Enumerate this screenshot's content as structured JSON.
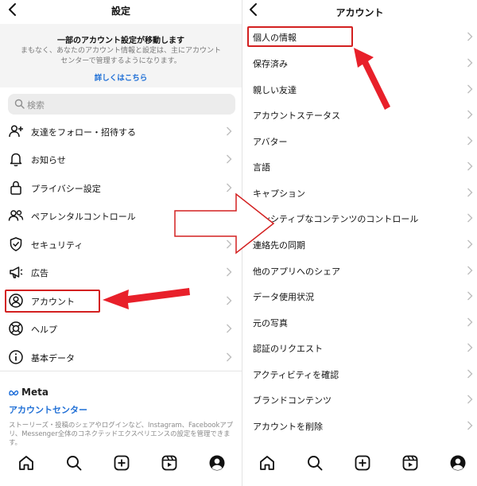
{
  "left_panel": {
    "title": "設定",
    "notice": {
      "title": "一部のアカウント設定が移動します",
      "body": "まもなく、あなたのアカウント情報と設定は、主にアカウントセンターで管理するようになります。",
      "link": "詳しくはこちら"
    },
    "search_placeholder": "検索",
    "items": [
      {
        "label": "友達をフォロー・招待する",
        "icon": "add-person-icon"
      },
      {
        "label": "お知らせ",
        "icon": "bell-icon"
      },
      {
        "label": "プライバシー設定",
        "icon": "lock-icon"
      },
      {
        "label": "ペアレンタルコントロール",
        "icon": "people-icon"
      },
      {
        "label": "セキュリティ",
        "icon": "shield-check-icon"
      },
      {
        "label": "広告",
        "icon": "megaphone-icon"
      },
      {
        "label": "アカウント",
        "icon": "user-circle-icon"
      },
      {
        "label": "ヘルプ",
        "icon": "lifebuoy-icon"
      },
      {
        "label": "基本データ",
        "icon": "info-icon"
      }
    ],
    "meta_logo": "Meta",
    "accounts_center": "アカウントセンター",
    "accounts_center_desc": "ストーリーズ・投稿のシェアやログインなど、Instagram、Facebookアプリ、Messenger全体のコネクテッドエクスペリエンスの設定を管理できます。"
  },
  "right_panel": {
    "title": "アカウント",
    "items": [
      "個人の情報",
      "保存済み",
      "親しい友達",
      "アカウントステータス",
      "アバター",
      "言語",
      "キャプション",
      "センシティブなコンテンツのコントロール",
      "連絡先の同期",
      "他のアプリへのシェア",
      "データ使用状況",
      "元の写真",
      "認証のリクエスト",
      "アクティビティを確認",
      "ブランドコンテンツ",
      "アカウントを削除"
    ]
  },
  "tab_icons": [
    "home-icon",
    "search-icon",
    "create-icon",
    "reels-icon",
    "profile-icon"
  ],
  "colors": {
    "highlight": "#d32020",
    "arrow": "#e8202a",
    "link": "#1f6fd6"
  }
}
